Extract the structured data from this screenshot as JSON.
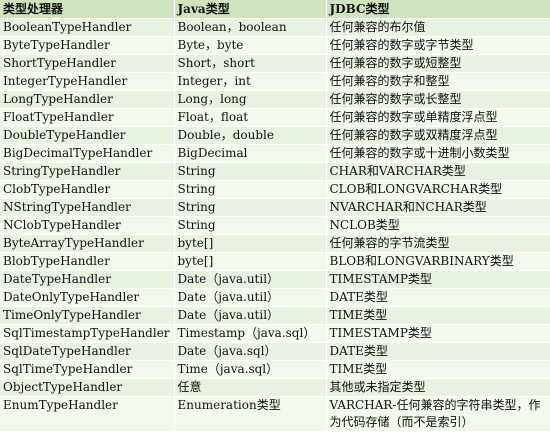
{
  "table": {
    "headers": [
      "类型处理器",
      "Java类型",
      "JDBC类型"
    ],
    "rows": [
      [
        "BooleanTypeHandler",
        "Boolean，boolean",
        "任何兼容的布尔值"
      ],
      [
        "ByteTypeHandler",
        "Byte，byte",
        "任何兼容的数字或字节类型"
      ],
      [
        "ShortTypeHandler",
        "Short，short",
        "任何兼容的数字或短整型"
      ],
      [
        "IntegerTypeHandler",
        "Integer，int",
        "任何兼容的数字和整型"
      ],
      [
        "LongTypeHandler",
        "Long，long",
        "任何兼容的数字或长整型"
      ],
      [
        "FloatTypeHandler",
        "Float，float",
        "任何兼容的数字或单精度浮点型"
      ],
      [
        "DoubleTypeHandler",
        "Double，double",
        "任何兼容的数字或双精度浮点型"
      ],
      [
        "BigDecimalTypeHandler",
        "BigDecimal",
        "任何兼容的数字或十进制小数类型"
      ],
      [
        "StringTypeHandler",
        "String",
        "CHAR和VARCHAR类型"
      ],
      [
        "ClobTypeHandler",
        "String",
        "CLOB和LONGVARCHAR类型"
      ],
      [
        "NStringTypeHandler",
        "String",
        "NVARCHAR和NCHAR类型"
      ],
      [
        "NClobTypeHandler",
        "String",
        "NCLOB类型"
      ],
      [
        "ByteArrayTypeHandler",
        "byte[]",
        "任何兼容的字节流类型"
      ],
      [
        "BlobTypeHandler",
        "byte[]",
        "BLOB和LONGVARBINARY类型"
      ],
      [
        "DateTypeHandler",
        "Date（java.util）",
        "TIMESTAMP类型"
      ],
      [
        "DateOnlyTypeHandler",
        "Date（java.util）",
        "DATE类型"
      ],
      [
        "TimeOnlyTypeHandler",
        "Date（java.util）",
        "TIME类型"
      ],
      [
        "SqlTimestampTypeHandler",
        "Timestamp（java.sql）",
        "TIMESTAMP类型"
      ],
      [
        "SqlDateTypeHandler",
        "Date（java.sql）",
        "DATE类型"
      ],
      [
        "SqlTimeTypeHandler",
        "Time（java.sql）",
        "TIME类型"
      ],
      [
        "ObjectTypeHandler",
        "任意",
        "其他或未指定类型"
      ],
      [
        "EnumTypeHandler",
        "Enumeration类型",
        "VARCHAR-任何兼容的字符串类型，作为代码存储（而不是索引）"
      ]
    ]
  }
}
